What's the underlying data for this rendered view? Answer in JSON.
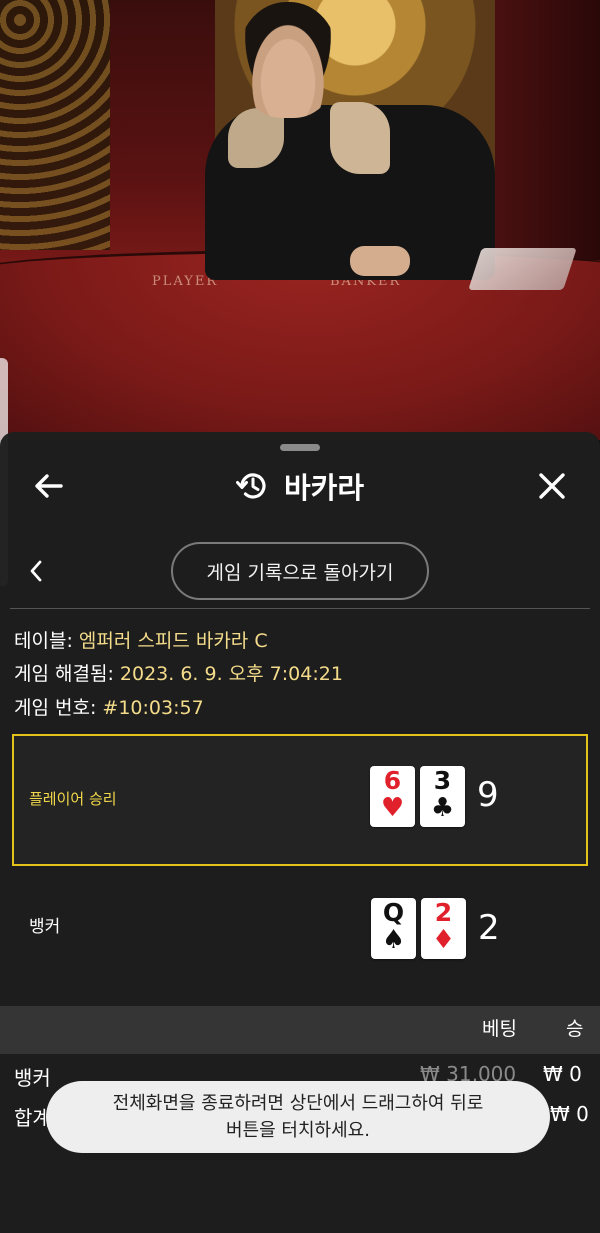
{
  "video": {
    "felt_player": "PLAYER",
    "felt_banker": "BANKER"
  },
  "header": {
    "title": "바카라",
    "back_icon": "arrow-left-icon",
    "history_icon": "history-icon",
    "close_icon": "close-icon"
  },
  "nav": {
    "back_to_history": "게임 기록으로 돌아가기"
  },
  "details": {
    "table_label": "테이블: ",
    "table_value": "엠퍼러 스피드 바카라 C",
    "resolved_label": "게임 해결됨: ",
    "resolved_value": "2023. 6. 9. 오후 7:04:21",
    "game_no_label": "게임 번호: ",
    "game_no_value": "#10:03:57"
  },
  "result": {
    "player": {
      "label": "플레이어 승리",
      "cards": [
        {
          "rank": "6",
          "suit": "♥",
          "color": "#e0202a"
        },
        {
          "rank": "3",
          "suit": "♣",
          "color": "#111111"
        }
      ],
      "score": "9"
    },
    "banker": {
      "label": "뱅커",
      "cards": [
        {
          "rank": "Q",
          "suit": "♠",
          "color": "#111111"
        },
        {
          "rank": "2",
          "suit": "♦",
          "color": "#e0202a"
        }
      ],
      "score": "2"
    }
  },
  "bets": {
    "headers": {
      "bet": "베팅",
      "win": "승"
    },
    "rows": [
      {
        "name": "뱅커",
        "bet": "₩ 31,000",
        "win": "₩ 0"
      },
      {
        "name": "합계",
        "win": "₩ 0"
      }
    ]
  },
  "toast": {
    "line1": "전체화면을 종료하려면 상단에서 드래그하여 뒤로",
    "line2": "버튼을 터치하세요."
  },
  "colors": {
    "accent": "#e3c21a",
    "value_text": "#f4dc8a",
    "red_suit": "#e0202a"
  }
}
